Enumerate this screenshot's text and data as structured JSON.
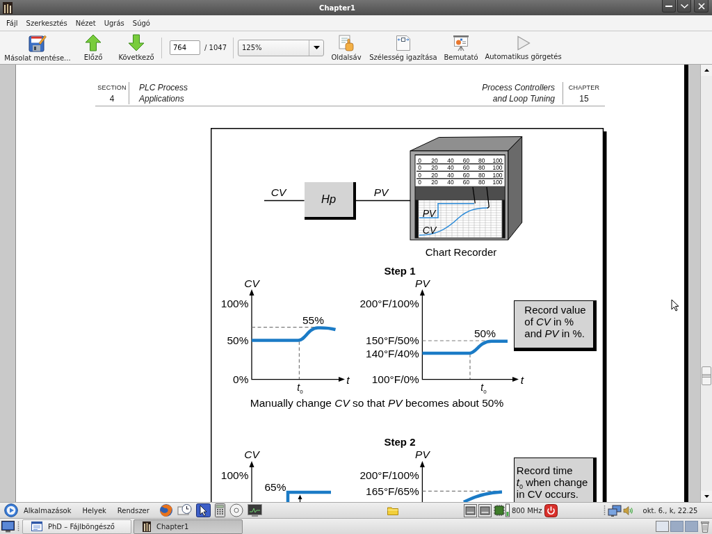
{
  "window": {
    "title": "Chapter1"
  },
  "menu": [
    "Fájl",
    "Szerkesztés",
    "Nézet",
    "Ugrás",
    "Súgó"
  ],
  "toolbar": {
    "nav": [
      {
        "kind": "save",
        "label": "Másolat mentése..."
      },
      {
        "kind": "previous",
        "label": "Előző"
      },
      {
        "kind": "next",
        "label": "Következő"
      }
    ],
    "page": {
      "value": "764",
      "total": "/ 1047"
    },
    "zoom": {
      "value": "125%"
    },
    "view": [
      {
        "kind": "sidebar",
        "label": "Oldalsáv"
      },
      {
        "kind": "fit_width",
        "label": "Szélesség igazítása"
      },
      {
        "kind": "presentation",
        "label": "Bemutató"
      },
      {
        "kind": "autoscroll",
        "label": "Automatikus görgetés"
      }
    ]
  },
  "document": {
    "header": {
      "section_label": "SECTION",
      "section_number": "4",
      "section_title": "PLC Process\nApplications",
      "chapter_title": "Process Controllers\nand Loop Tuning",
      "chapter_label": "CHAPTER",
      "chapter_number": "15"
    },
    "figure": {
      "block_diagram": {
        "input": "CV",
        "block": "Hp",
        "output": "PV"
      },
      "recorder": {
        "scale_rows": [
          [
            "0",
            "20",
            "40",
            "60",
            "80",
            "100"
          ],
          [
            "0",
            "20",
            "40",
            "60",
            "80",
            "100"
          ],
          [
            "0",
            "20",
            "40",
            "60",
            "80",
            "100"
          ],
          [
            "0",
            "20",
            "40",
            "60",
            "80",
            "100"
          ]
        ],
        "trace_labels": [
          "PV",
          "CV"
        ],
        "caption": "Chart Recorder"
      },
      "steps": [
        {
          "title": "Step 1",
          "plots": [
            {
              "axis": "CV",
              "ticks": [
                "100%",
                "50%",
                "0%"
              ],
              "value_label": "55%",
              "time_axis": "t",
              "time_marker": "*t*$_{0}$"
            },
            {
              "axis": "PV",
              "ticks": [
                "200°F/100%",
                "150°F/50%",
                "140°F/40%",
                "100°F/0%"
              ],
              "value_label": "50%",
              "time_axis": "t",
              "time_marker": "*t*$_{0}$"
            }
          ],
          "note": "Record value\nof *CV* in %\nand *PV* in %.",
          "caption": "Manually change *CV* so that *PV* becomes about 50%"
        },
        {
          "title": "Step 2",
          "plots": [
            {
              "axis": "CV",
              "ticks": [
                "100%"
              ],
              "value_label": "65%"
            },
            {
              "axis": "PV",
              "ticks": [
                "200°F/100%",
                "165°F/65%"
              ]
            }
          ],
          "note": "Record time\n*t*$_{0}$ when change\nin CV occurs."
        }
      ]
    }
  },
  "panel": {
    "menus": [
      "Alkalmazások",
      "Helyek",
      "Rendszer"
    ],
    "launchers": [
      {
        "kind": "browser"
      },
      {
        "kind": "clock"
      },
      {
        "kind": "pointer"
      },
      {
        "kind": "calculator"
      },
      {
        "kind": "disc"
      },
      {
        "kind": "monitor"
      }
    ],
    "cpu_frequency": "800 MHz",
    "clock": "okt. 6., k, 22.25"
  },
  "taskbar": {
    "windows": [
      {
        "kind": "file_manager",
        "title": "PhD – Fájlböngésző",
        "selected": false
      },
      {
        "kind": "document",
        "title": "Chapter1",
        "selected": true
      }
    ],
    "workspaces": [
      {
        "selected": true
      },
      {
        "selected": false
      },
      {
        "selected": false
      }
    ]
  }
}
